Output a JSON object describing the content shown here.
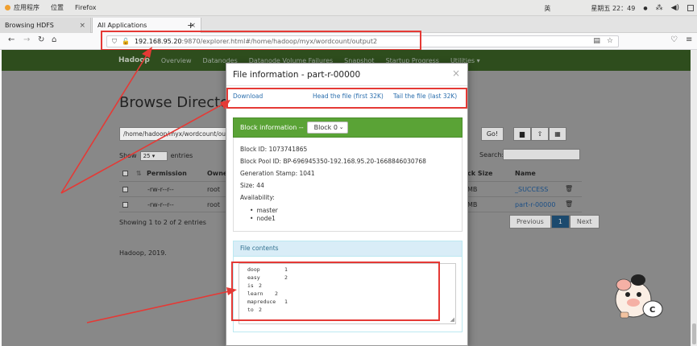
{
  "topbar": {
    "apps": "应用程序",
    "places": "位置",
    "firefox": "Firefox",
    "lang": "英",
    "clock": "星期五 22：49",
    "clock_icon": "●"
  },
  "tabs": [
    {
      "label": "Browsing HDFS",
      "close": "×"
    },
    {
      "label": "All Applications",
      "close": "×"
    }
  ],
  "new_tab": "+",
  "nav": {
    "back": "←",
    "forward": "→",
    "reload": "↻",
    "home": "⌂",
    "url_host": "192.168.95.20",
    "url_rest": ":9870/explorer.html#/home/hadoop/myx/wordcount/output2",
    "reader_icon": "▤",
    "star_icon": "☆",
    "pocket_icon": "♡",
    "menu_icon": "≡"
  },
  "hadoop_nav": {
    "brand": "Hadoop",
    "items": [
      "Overview",
      "Datanodes",
      "Datanode Volume Failures",
      "Snapshot",
      "Startup Progress",
      "Utilities ▾"
    ]
  },
  "background": {
    "title": "Browse Directo",
    "path": "/home/hadoop/myx/wordcount/outp",
    "go": "Go!",
    "btn_folder": "▆",
    "btn_upload": "⇧",
    "btn_table": "▦",
    "show": "Show",
    "show_value": "25 ▾",
    "entries": "entries",
    "search": "Search:",
    "headers": {
      "permission": "Permission",
      "owner": "Owne",
      "block_size": "ck Size",
      "name": "Name"
    },
    "rows": [
      {
        "permission": "-rw-r--r--",
        "owner": "root",
        "block_size": "MB",
        "name": "_SUCCESS",
        "trash": "🗑"
      },
      {
        "permission": "-rw-r--r--",
        "owner": "root",
        "block_size": "MB",
        "name": "part-r-00000",
        "trash": "🗑"
      }
    ],
    "sort_icon": "⇅",
    "showing": "Showing 1 to 2 of 2 entries",
    "pager": {
      "previous": "Previous",
      "page": "1",
      "next": "Next"
    },
    "footer": "Hadoop, 2019."
  },
  "modal": {
    "title": "File information - part-r-00000",
    "close": "×",
    "download": "Download",
    "head": "Head the file (first 32K)",
    "tail": "Tail the file (last 32K)",
    "block_info_label": "Block information --",
    "block_select": "Block 0",
    "block_id": "Block ID: 1073741865",
    "block_pool": "Block Pool ID: BP-696945350-192.168.95.20-1668846030768",
    "gen_stamp": "Generation Stamp: 1041",
    "size": "Size: 44",
    "availability": "Availability:",
    "nodes": [
      "master",
      "node1"
    ],
    "file_contents_label": "File contents",
    "file_rows": [
      {
        "word": "doop",
        "count": "1"
      },
      {
        "word": "easy",
        "count": "2"
      },
      {
        "word": "is",
        "count": "2"
      },
      {
        "word": "learn",
        "count": "2"
      },
      {
        "word": "mapreduce",
        "count": "1"
      },
      {
        "word": "to",
        "count": "2"
      }
    ],
    "grip": "◢"
  },
  "colors": {
    "annotation_red": "#e53935",
    "panel_green": "#5aa336",
    "link_blue": "#2a6ead",
    "info_blue": "#d9edf7"
  }
}
